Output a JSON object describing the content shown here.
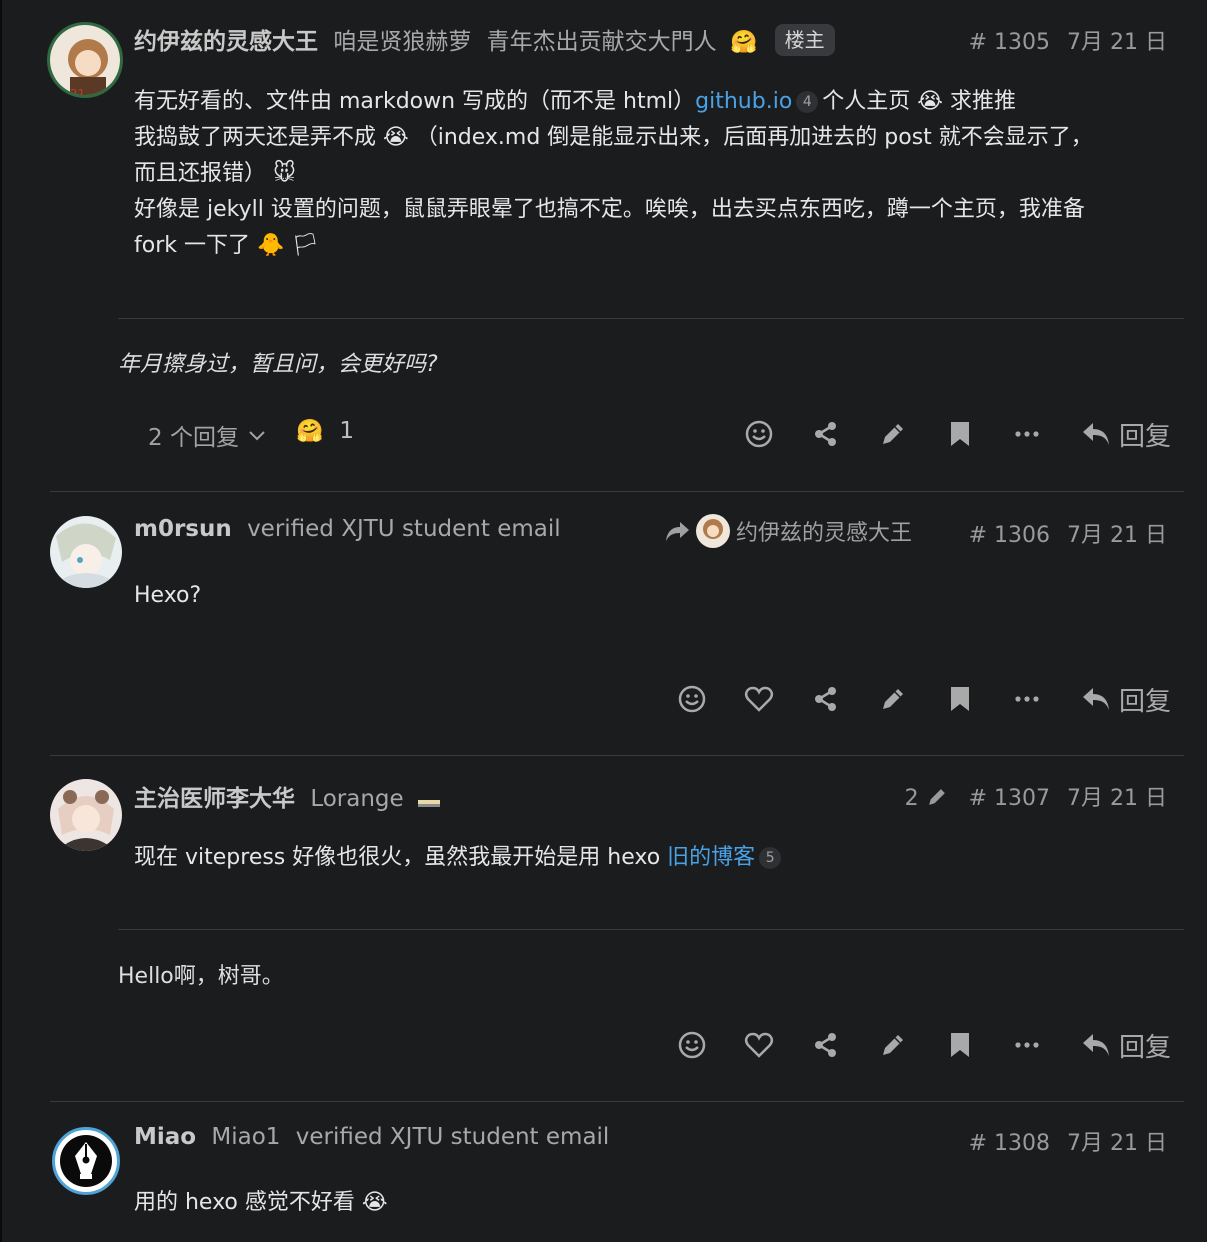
{
  "posts": [
    {
      "username": "约伊兹的灵感大王",
      "fullname": "咱是贤狼赫萝",
      "title": "青年杰出贡献交大門人",
      "badge": "楼主",
      "post_number": "# 1305",
      "date": "7月 21 日",
      "line1_a": "有无好看的、文件由 markdown 写成的（而不是 html）",
      "link": "github.io",
      "link_count": "4",
      "line1_b": "个人主页",
      "line1_c": "求推推",
      "line2_a": "我捣鼓了两天还是弄不成",
      "line2_b": "（index.md 倒是能显示出来，后面再加进去的 post 就不会显示了，",
      "line3": "而且还报错）",
      "line4": "好像是 jekyll 设置的问题，鼠鼠弄眼晕了也搞不定。唉唉，出去买点东西吃，蹲一个主页，我准备",
      "line5": "fork 一下了",
      "signature": "年月擦身过，暂且问，会更好吗?",
      "replies_label": "2 个回复",
      "reaction_count": "1",
      "reply_label": "回复"
    },
    {
      "username": "m0rsun",
      "title": "verified XJTU student email",
      "reply_to": "约伊兹的灵感大王",
      "post_number": "# 1306",
      "date": "7月 21 日",
      "text": "Hexo?",
      "reply_label": "回复"
    },
    {
      "username": "主治医师李大华",
      "fullname": "Lorange",
      "edit_count": "2",
      "post_number": "# 1307",
      "date": "7月 21 日",
      "text_a": "现在 vitepress 好像也很火，虽然我最开始是用 hexo",
      "link": "旧的博客",
      "link_count": "5",
      "signature": "Hello啊，树哥。",
      "reply_label": "回复"
    },
    {
      "username": "Miao",
      "fullname": "Miao1",
      "title": "verified XJTU student email",
      "post_number": "# 1308",
      "date": "7月 21 日",
      "text": "用的 hexo 感觉不好看"
    }
  ],
  "emoji": {
    "hug": "🤗",
    "cry": "😭",
    "mouse": "🐭",
    "chick": "🐥",
    "flag": "🏳"
  },
  "colors": {
    "background": "#1b1c1e",
    "link": "#4aa2e6",
    "muted": "#a8a8a8"
  }
}
